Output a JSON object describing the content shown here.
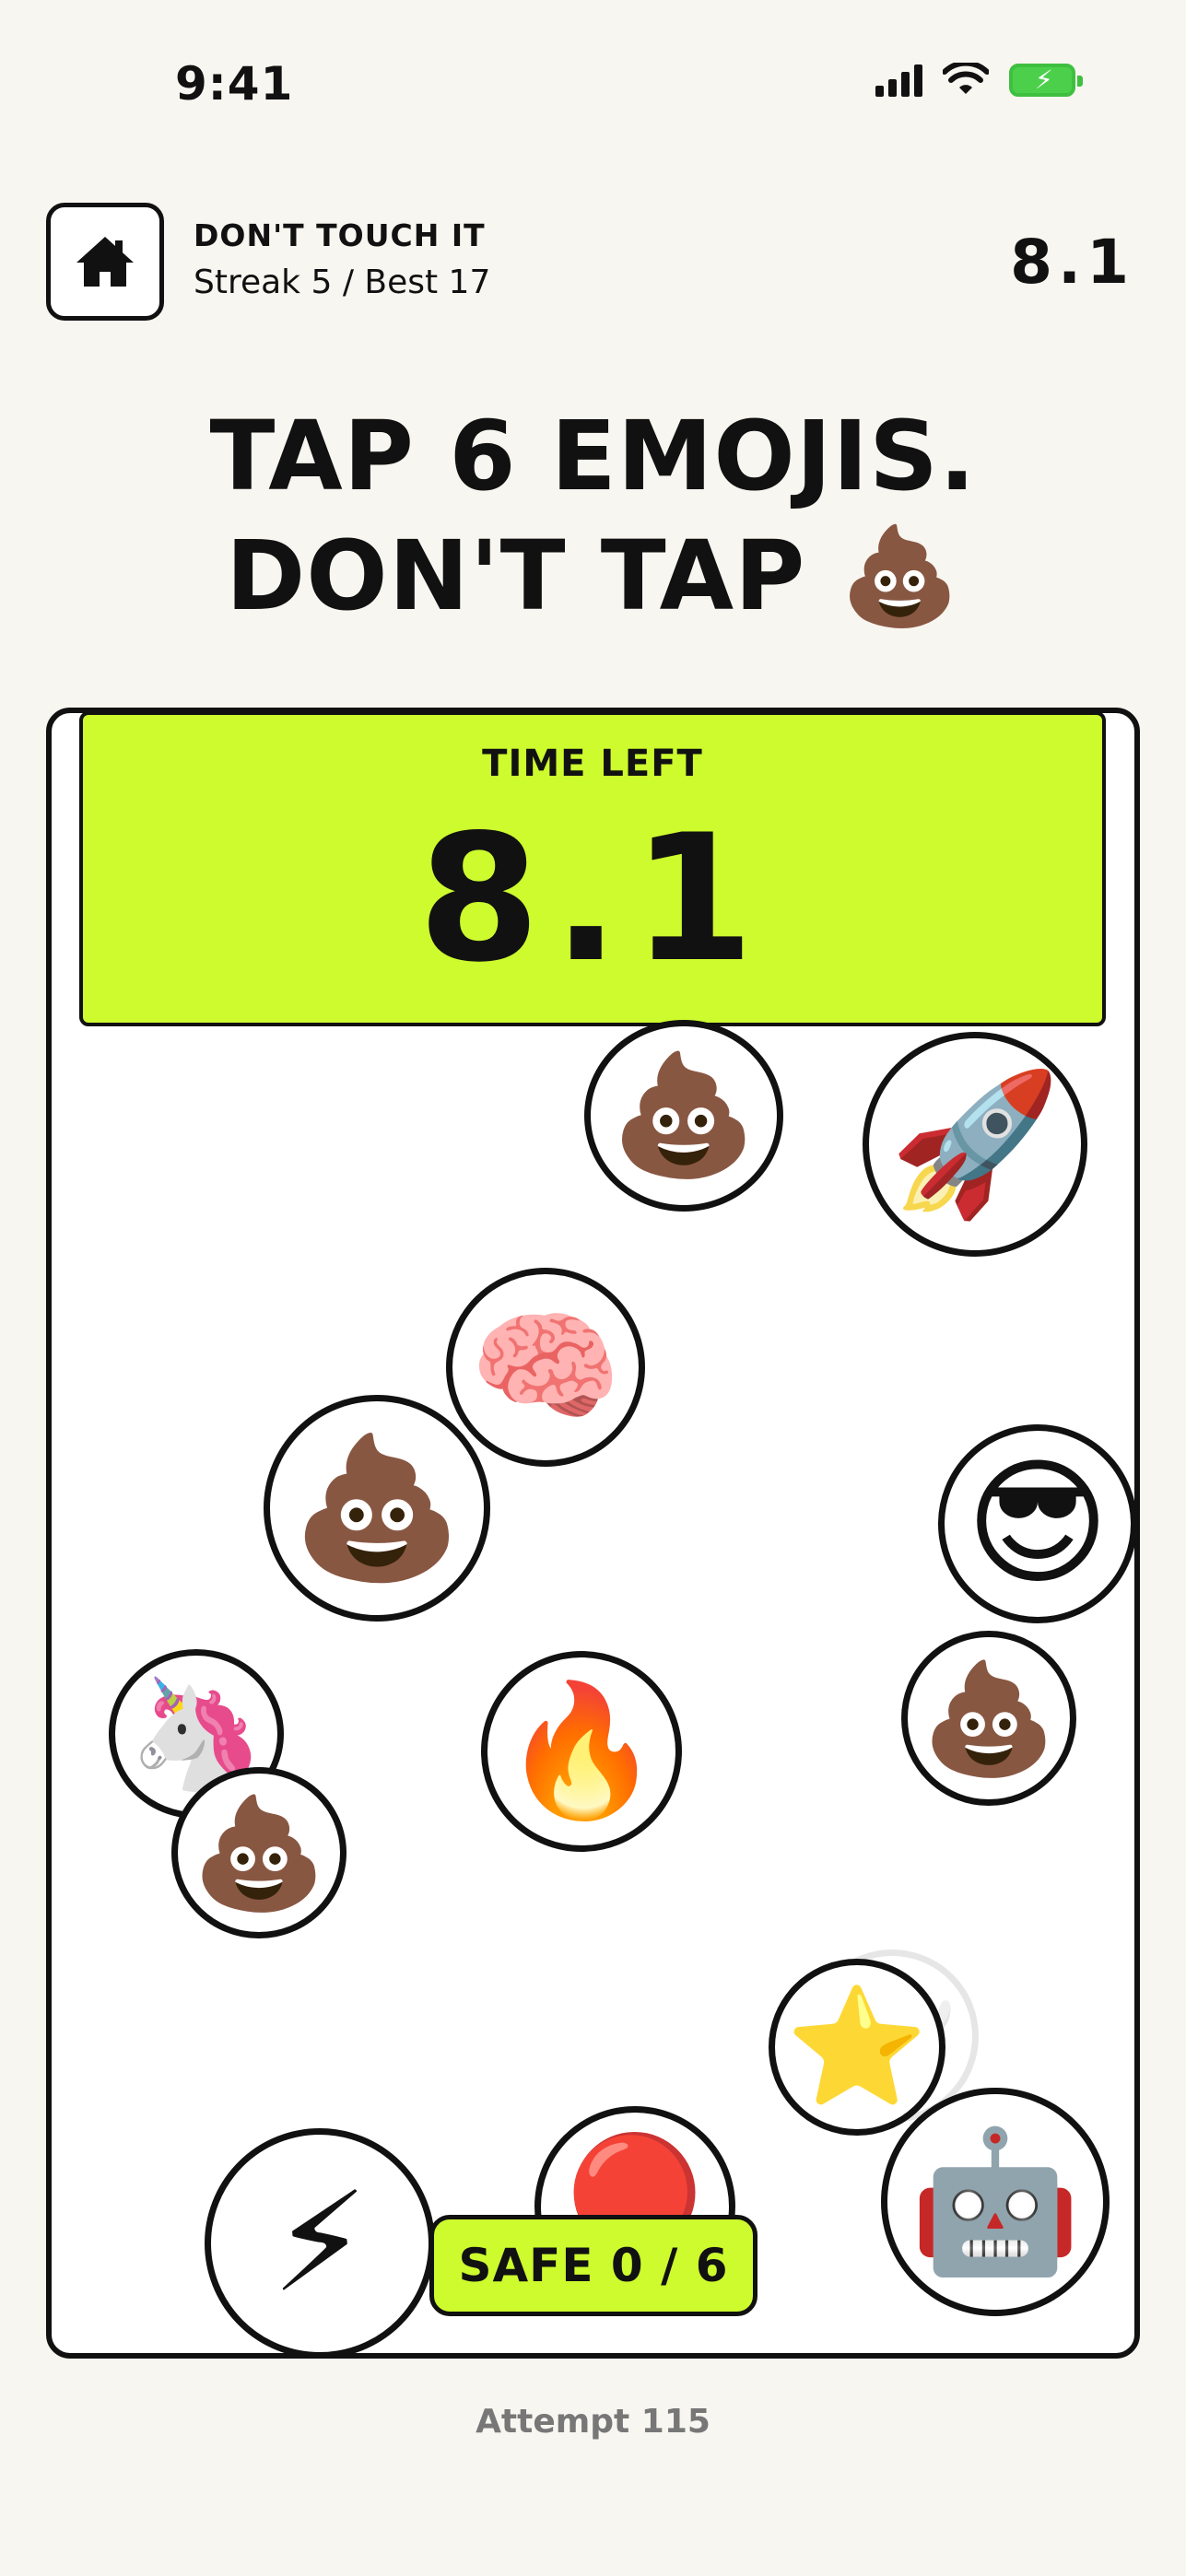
{
  "status_bar": {
    "time": "9:41"
  },
  "header": {
    "home_icon": "home-icon",
    "title": "DON'T TOUCH IT",
    "subtitle": "Streak 5 / Best 17",
    "timer": "8.1"
  },
  "instruction": {
    "line1": "TAP 6 EMOJIS.",
    "line2": "DON'T TAP 💩"
  },
  "time_panel": {
    "label": "TIME LEFT",
    "value": "8.1",
    "color": "#cdfb2e"
  },
  "emojis": [
    {
      "name": "poop-emoji-top",
      "char": "💩",
      "icon": "poop-icon"
    },
    {
      "name": "rocket-emoji",
      "char": "🚀",
      "icon": "rocket-icon"
    },
    {
      "name": "brain-emoji",
      "char": "🧠",
      "icon": "brain-icon"
    },
    {
      "name": "poop-emoji-left",
      "char": "💩",
      "icon": "poop-icon"
    },
    {
      "name": "sunglasses-emoji",
      "char": "😎",
      "icon": "sunglasses-face-icon"
    },
    {
      "name": "unicorn-emoji",
      "char": "🦄",
      "icon": "unicorn-icon"
    },
    {
      "name": "fire-emoji",
      "char": "🔥",
      "icon": "fire-icon"
    },
    {
      "name": "poop-emoji-right",
      "char": "💩",
      "icon": "poop-icon"
    },
    {
      "name": "poop-emoji-bottom-left",
      "char": "💩",
      "icon": "poop-icon"
    },
    {
      "name": "ghost-emoji",
      "char": "👻",
      "icon": "ghost-icon"
    },
    {
      "name": "star-emoji",
      "char": "⭐",
      "icon": "star-icon"
    },
    {
      "name": "robot-emoji",
      "char": "🤖",
      "icon": "robot-icon"
    },
    {
      "name": "lightning-emoji",
      "char": "⚡",
      "icon": "lightning-icon"
    },
    {
      "name": "red-ball-emoji",
      "char": "🔴",
      "icon": "red-circle-icon"
    }
  ],
  "safe_counter": "SAFE 0 / 6",
  "attempt": "Attempt 115"
}
